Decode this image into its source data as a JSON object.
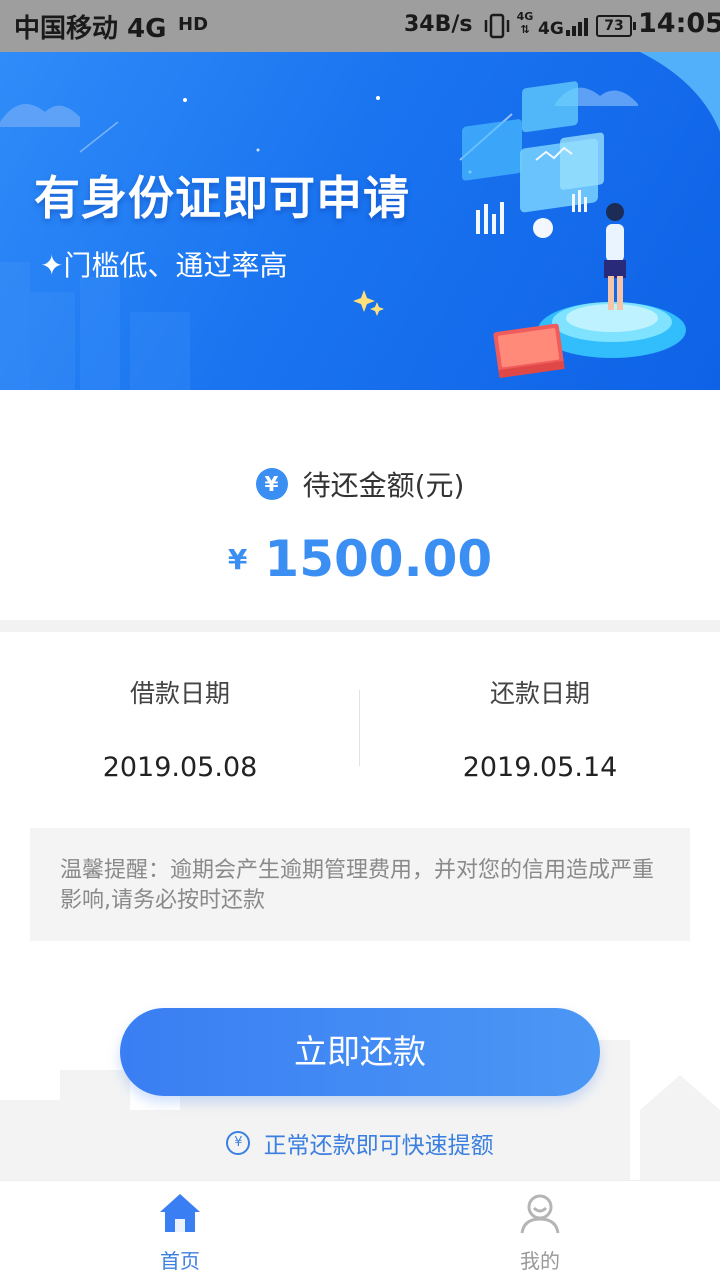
{
  "status_bar": {
    "carrier": "中国移动 4G",
    "hd": "HD",
    "speed": "34B/s",
    "net_type": "4G",
    "battery": "73",
    "time": "14:05"
  },
  "banner": {
    "title": "有身份证即可申请",
    "subtitle": "✦门槛低、通过率高"
  },
  "amount": {
    "icon": "yen-icon",
    "icon_glyph": "¥",
    "label": "待还金额(元)",
    "currency": "¥",
    "value": "1500.00",
    "accent_color": "#3b8ff2"
  },
  "dates": {
    "loan_label": "借款日期",
    "loan_date": "2019.05.08",
    "repay_label": "还款日期",
    "repay_date": "2019.05.14"
  },
  "reminder": {
    "text": "温馨提醒：逾期会产生逾期管理费用，并对您的信用造成严重影响,请务必按时还款"
  },
  "cta": {
    "label": "立即还款"
  },
  "tip": {
    "icon": "yen-shield-icon",
    "icon_glyph": "¥",
    "text": "正常还款即可快速提额"
  },
  "bottom_nav": {
    "items": [
      {
        "label": "首页",
        "icon": "home-icon",
        "active": true
      },
      {
        "label": "我的",
        "icon": "profile-icon",
        "active": false
      }
    ]
  }
}
